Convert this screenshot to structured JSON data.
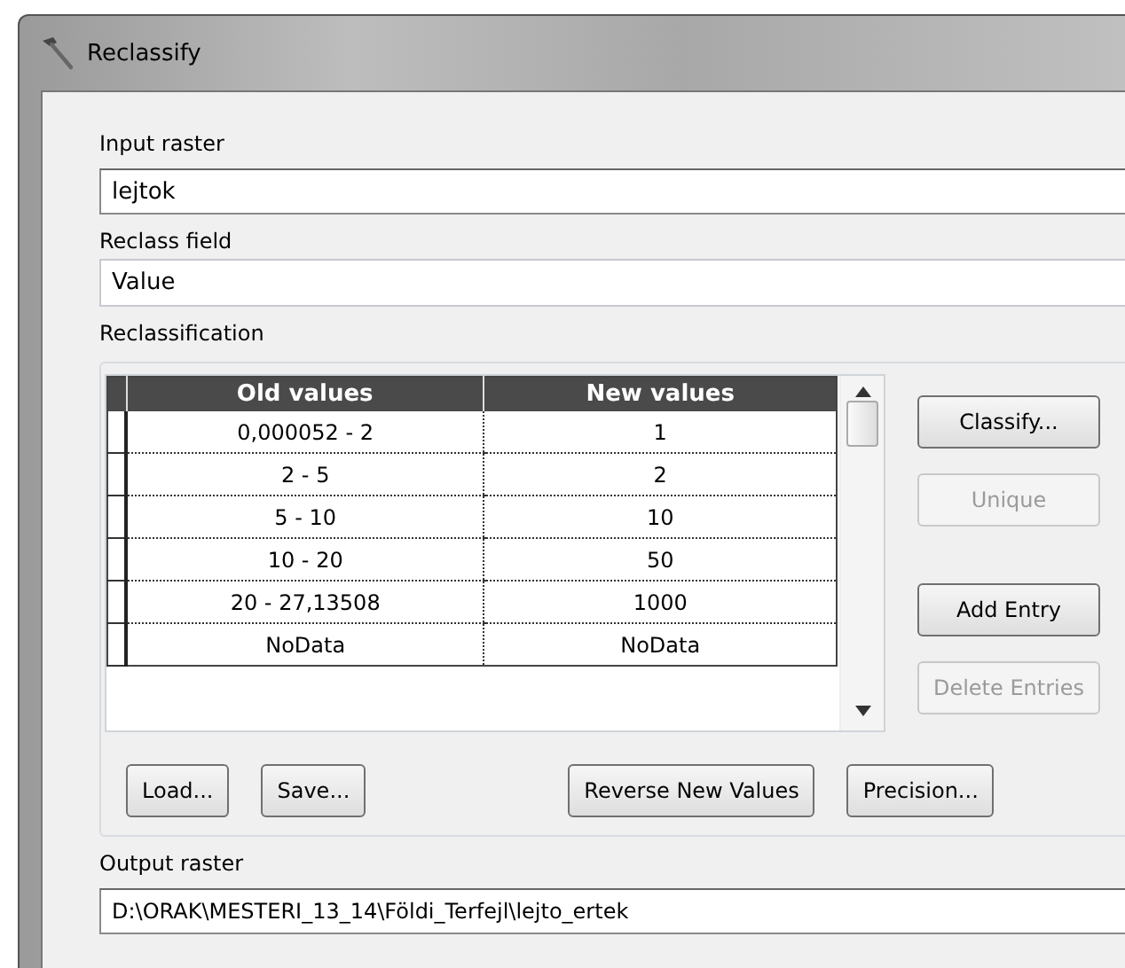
{
  "window": {
    "title": "Reclassify"
  },
  "input_raster": {
    "label": "Input raster",
    "value": "lejtok"
  },
  "reclass_field": {
    "label": "Reclass field",
    "value": "Value"
  },
  "reclassification": {
    "label": "Reclassification",
    "table": {
      "columns": [
        "Old values",
        "New values"
      ],
      "rows": [
        {
          "old": "0,000052 - 2",
          "new": "1"
        },
        {
          "old": "2 - 5",
          "new": "2"
        },
        {
          "old": "5 - 10",
          "new": "10"
        },
        {
          "old": "10 - 20",
          "new": "50"
        },
        {
          "old": "20 - 27,13508",
          "new": "1000"
        },
        {
          "old": "NoData",
          "new": "NoData"
        }
      ]
    },
    "side_buttons": [
      {
        "label": "Classify...",
        "disabled": false
      },
      {
        "label": "Unique",
        "disabled": true
      },
      {
        "label": "Add Entry",
        "disabled": false
      },
      {
        "label": "Delete Entries",
        "disabled": true
      }
    ],
    "bottom_buttons": [
      {
        "label": "Load...",
        "disabled": false
      },
      {
        "label": "Save...",
        "disabled": false
      },
      {
        "label": "Reverse New Values",
        "disabled": false
      },
      {
        "label": "Precision...",
        "disabled": false
      }
    ]
  },
  "output_raster": {
    "label": "Output raster",
    "value": "D:\\ORAK\\MESTERI_13_14\\Földi_Terfejl\\lejto_ertek"
  }
}
